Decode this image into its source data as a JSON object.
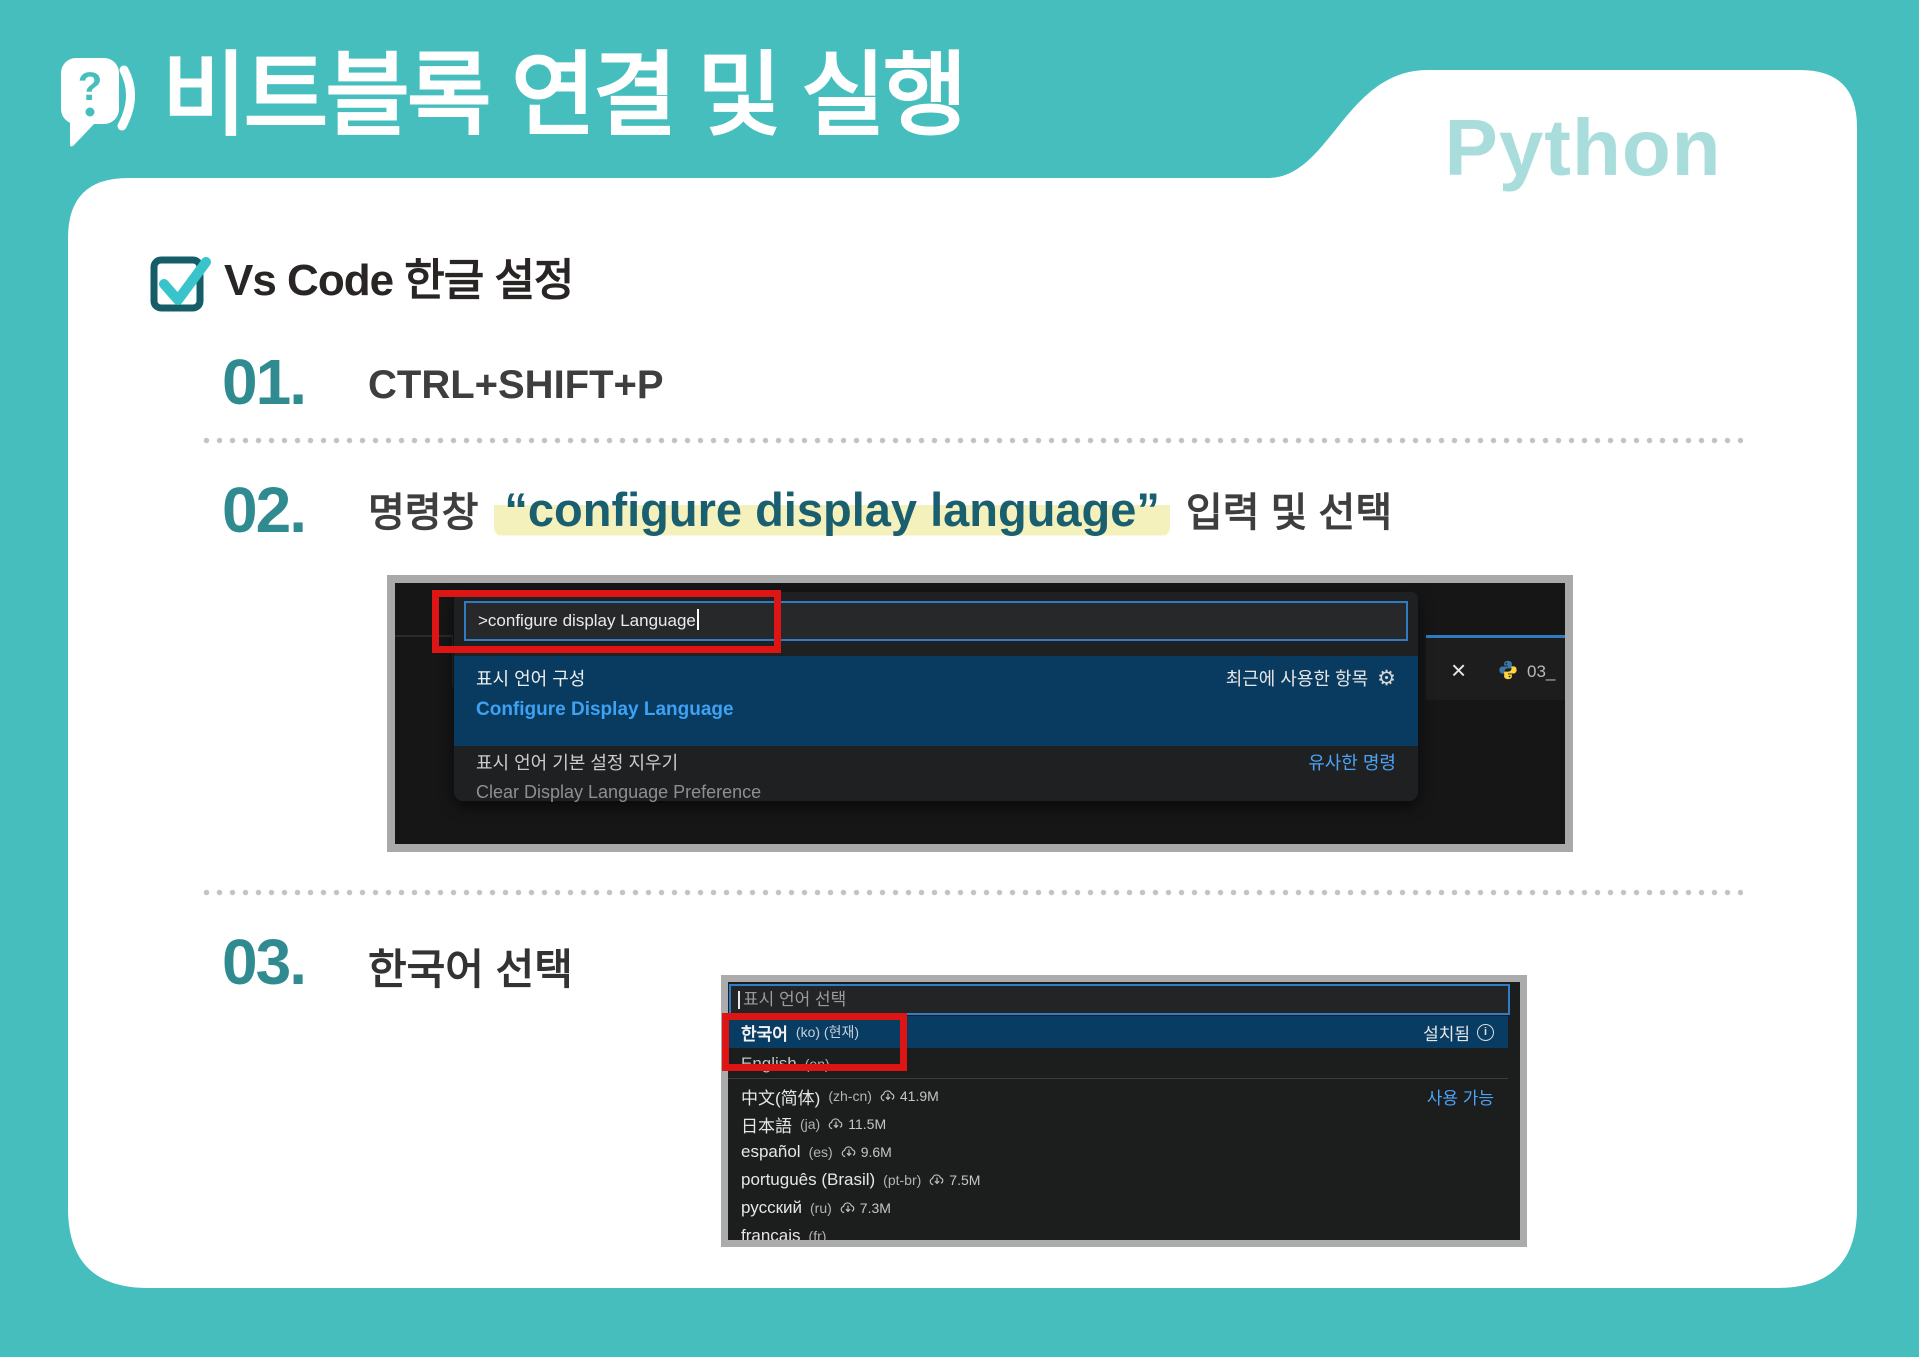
{
  "header": {
    "title": "비트블록 연결 및 실행",
    "python_label": "Python",
    "bubble_icon": "question-speech-bubble"
  },
  "section": {
    "heading": "Vs Code 한글 설정"
  },
  "steps": {
    "s1": {
      "num": "01.",
      "text": "CTRL+SHIFT+P"
    },
    "s2": {
      "num": "02.",
      "prefix": "명령창",
      "highlight": "“configure display language”",
      "suffix": "입력 및 선택"
    },
    "s3": {
      "num": "03.",
      "text": "한국어 선택"
    }
  },
  "palette1": {
    "input_value": ">configure display Language",
    "item1": {
      "title": "표시 언어 구성",
      "subtitle": "Configure Display Language",
      "badge": "최근에 사용한 항목",
      "gear_icon": "⚙"
    },
    "item2": {
      "title": "표시 언어 기본 설정 지우기",
      "subtitle": "Clear Display Language Preference",
      "badge": "유사한 명령"
    },
    "editor_tab": {
      "close_label": "×",
      "file_label": "03_"
    }
  },
  "palette2": {
    "placeholder": "표시 언어 선택",
    "rows": [
      {
        "name": "한국어",
        "meta": "(ko) (현재)",
        "badge": "설치됨"
      },
      {
        "name": "English",
        "meta": "(en)"
      },
      {
        "name": "中文(简体)",
        "meta": "(zh-cn)",
        "size": "41.9M",
        "badge": "사용 가능"
      },
      {
        "name": "日本語",
        "meta": "(ja)",
        "size": "11.5M"
      },
      {
        "name": "español",
        "meta": "(es)",
        "size": "9.6M"
      },
      {
        "name": "português (Brasil)",
        "meta": "(pt-br)",
        "size": "7.5M"
      },
      {
        "name": "русский",
        "meta": "(ru)",
        "size": "7.3M"
      },
      {
        "name": "français",
        "meta": "(fr)"
      }
    ]
  },
  "colors": {
    "background_teal": "#46BEBE",
    "python_label": "#A8DDDC",
    "step_number_teal": "#2F8B8F",
    "highlight_yellow": "#F4F1BD",
    "highlight_text_teal": "#1A5F70",
    "annotation_red": "#DE1515",
    "vscode_selected_row_blue": "#093B60",
    "vscode_link_blue": "#3EA1F2",
    "focus_border_blue": "#2F7CC5"
  }
}
